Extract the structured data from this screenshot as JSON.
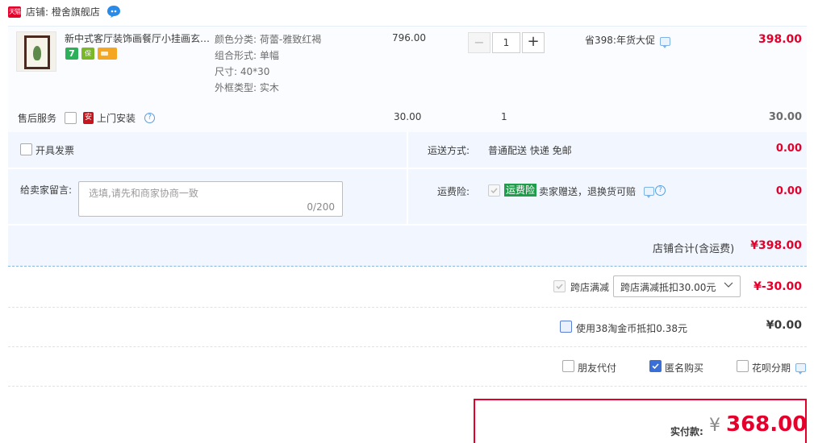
{
  "shop": {
    "badge": "天猫",
    "name": "店铺: 橙舍旗舰店"
  },
  "item": {
    "title": "新中式客厅装饰画餐厅小挂画玄…",
    "badge_7": "7",
    "badge_guarantee": "保",
    "sku": [
      "颜色分类: 荷蕾-雅致红褐",
      "组合形式: 单幅",
      "尺寸: 40*30",
      "外框类型: 实木"
    ],
    "unit_price": "796.00",
    "quantity": "1",
    "qty_minus": "−",
    "qty_plus": "+",
    "promotion": "省398:年货大促",
    "total": "398.00"
  },
  "service": {
    "label": "售后服务",
    "install_icon": "安",
    "install_label": "上门安装",
    "help": "?",
    "price": "30.00",
    "quantity": "1",
    "total": "30.00"
  },
  "invoice": {
    "label": "开具发票"
  },
  "shipping": {
    "label": "运送方式:",
    "value": "普通配送 快递 免邮",
    "cost": "0.00"
  },
  "message": {
    "label": "给卖家留言:",
    "placeholder": "选填,请先和商家协商一致",
    "count": "0/200"
  },
  "insurance": {
    "label": "运费险:",
    "badge": "运费险",
    "desc": "卖家赠送，退换货可赔",
    "cost": "0.00"
  },
  "shop_total": {
    "label": "店铺合计(含运费)",
    "value": "¥398.00"
  },
  "discount": {
    "label": "跨店满减",
    "selected": "跨店满减抵扣30.00元",
    "value": "¥-30.00"
  },
  "coins": {
    "label": "使用38淘金币抵扣0.38元",
    "value": "¥0.00"
  },
  "options": {
    "friend_pay": "朋友代付",
    "anonymous": "匿名购买",
    "huabei": "花呗分期"
  },
  "payment": {
    "label": "实付款:",
    "currency": "¥",
    "value": "368.00"
  },
  "colors": {
    "accent": "#e4002b",
    "panel": "#f2f7ff",
    "checkbox_checked": "#3b6fd8"
  }
}
